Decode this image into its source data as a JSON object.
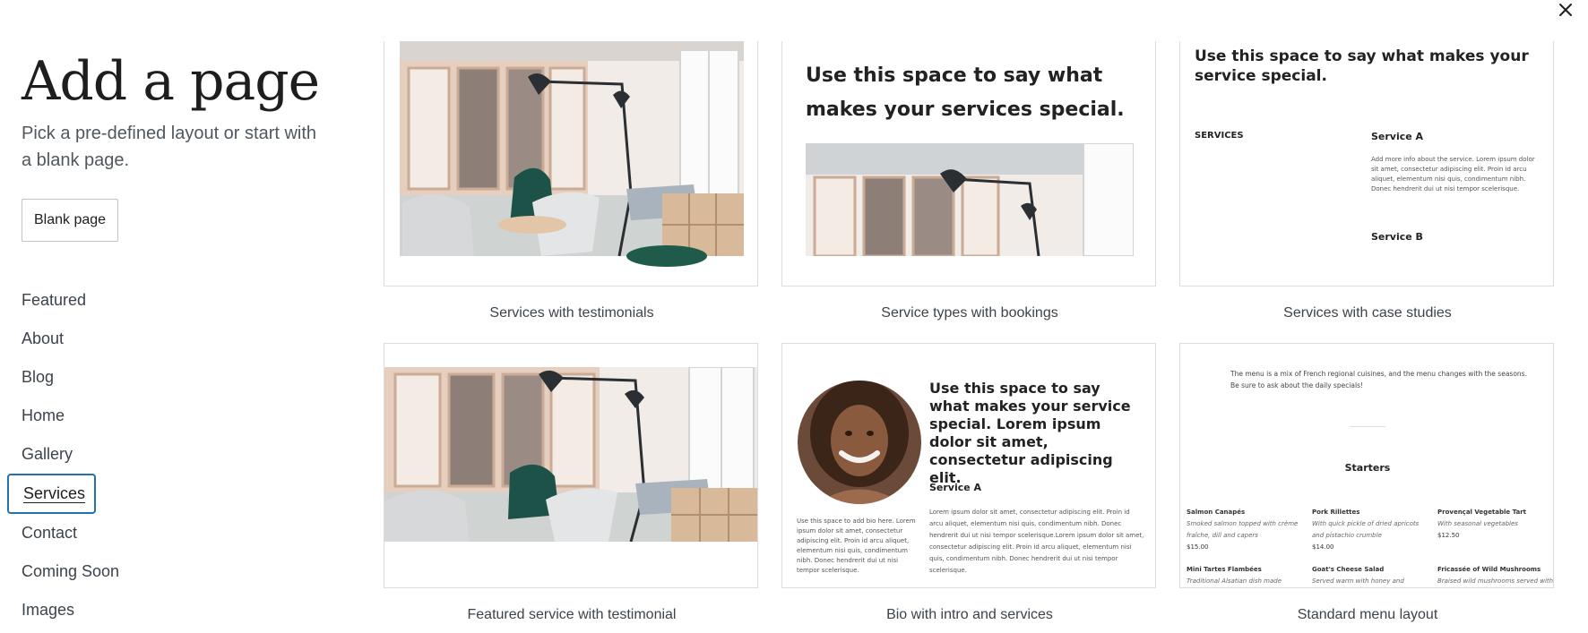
{
  "header": {
    "title": "Add a page",
    "subtitle": "Pick a pre-defined layout or start with a blank page.",
    "blank_page_label": "Blank page",
    "close_icon": "close-icon"
  },
  "categories": [
    {
      "label": "Featured",
      "active": false
    },
    {
      "label": "About",
      "active": false
    },
    {
      "label": "Blog",
      "active": false
    },
    {
      "label": "Home",
      "active": false
    },
    {
      "label": "Gallery",
      "active": false
    },
    {
      "label": "Services",
      "active": true
    },
    {
      "label": "Contact",
      "active": false
    },
    {
      "label": "Coming Soon",
      "active": false
    },
    {
      "label": "Images",
      "active": false
    }
  ],
  "patterns": [
    {
      "label": "Services with testimonials"
    },
    {
      "label": "Service types with bookings",
      "heading": "Use this space to say what makes your services special."
    },
    {
      "label": "Services with case studies",
      "heading": "Use this space to say what makes your service special.",
      "section_label": "SERVICES",
      "service_a": "Service A",
      "service_a_text": "Add more info about the service. Lorem ipsum dolor sit amet, consectetur adipiscing elit. Proin id arcu aliquet, elementum nisi quis, condimentum nibh. Donec hendrerit dui ut nisi tempor scelerisque.",
      "service_b": "Service B"
    },
    {
      "label": "Featured service with testimonial"
    },
    {
      "label": "Bio with intro and services",
      "heading": "Use this space to say what makes your service special. Lorem ipsum dolor sit amet, consectetur adipiscing elit.",
      "bio_text": "Use this space to add bio here. Lorem ipsum dolor sit amet, consectetur adipiscing elit. Proin id arcu aliquet, elementum nisi quis, condimentum nibh. Donec hendrerit dui ut nisi tempor scelerisque.",
      "service_a": "Service A",
      "service_a_text": "Lorem ipsum dolor sit amet, consectetur adipiscing elit. Proin id arcu aliquet, elementum nisi quis, condimentum nibh. Donec hendrerit dui ut nisi tempor scelerisque.Lorem ipsum dolor sit amet, consectetur adipiscing elit. Proin id arcu aliquet, elementum nisi quis, condimentum nibh. Donec hendrerit dui ut nisi tempor scelerisque."
    },
    {
      "label": "Standard menu layout",
      "intro_1": "The menu is a mix of French regional cuisines, and the menu changes with the seasons.",
      "intro_2": "Be sure to ask about the daily specials!",
      "section_title": "Starters",
      "items": [
        {
          "name": "Salmon Canapés",
          "desc_1": "Smoked salmon topped with crème",
          "desc_2": "fraîche, dill and capers",
          "price": "$15.00"
        },
        {
          "name": "Pork Rillettes",
          "desc_1": "With quick pickle of dried apricots",
          "desc_2": "and pistachio crumble",
          "price": "$14.00"
        },
        {
          "name": "Provençal Vegetable Tart",
          "desc_1": "With seasonal vegetables",
          "desc_2": "",
          "price": "$12.50"
        },
        {
          "name": "Mini Tartes Flambées",
          "desc_1": "Traditional Alsatian dish made",
          "desc_2": "",
          "price": ""
        },
        {
          "name": "Goat's Cheese Salad",
          "desc_1": "Served warm with honey and",
          "desc_2": "",
          "price": ""
        },
        {
          "name": "Fricassée of Wild Mushrooms",
          "desc_1": "Braised wild mushrooms served with",
          "desc_2": "",
          "price": ""
        }
      ]
    }
  ]
}
